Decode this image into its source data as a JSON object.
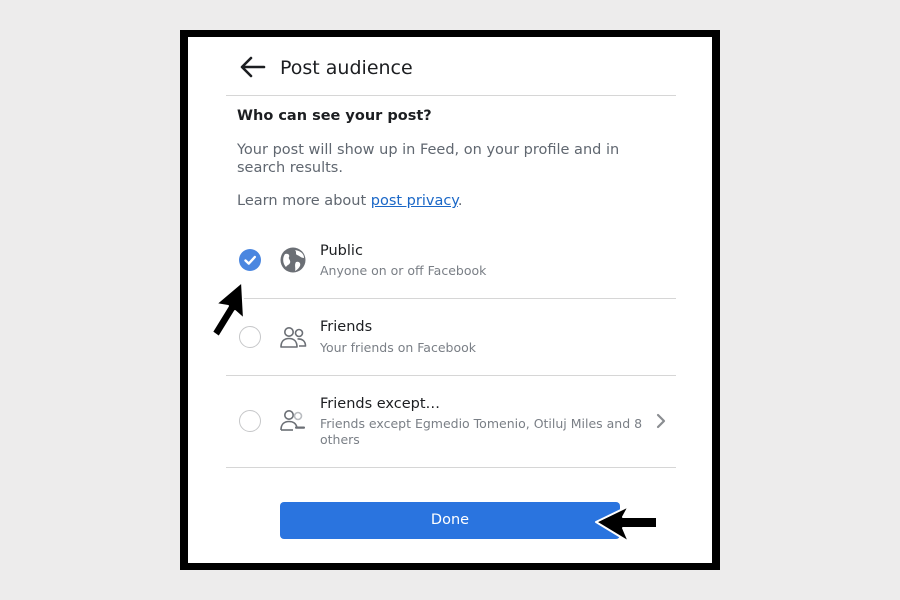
{
  "header": {
    "title": "Post audience",
    "back_icon": "arrow-left-icon"
  },
  "intro": {
    "question": "Who can see your post?",
    "description": "Your post will show up in Feed, on your profile and in search results.",
    "learn_more_prefix": "Learn more about ",
    "learn_more_link": "post privacy",
    "learn_more_suffix": "."
  },
  "options": [
    {
      "label": "Public",
      "subtitle": "Anyone on or off Facebook",
      "icon": "globe-icon",
      "selected": true
    },
    {
      "label": "Friends",
      "subtitle": "Your friends on Facebook",
      "icon": "friends-icon",
      "selected": false
    },
    {
      "label": "Friends except…",
      "subtitle": "Friends except Egmedio Tomenio, Otiluj Miles and 8 others",
      "icon": "friends-except-icon",
      "selected": false,
      "has_chevron": true
    }
  ],
  "footer": {
    "done_label": "Done"
  },
  "colors": {
    "accent": "#2a74df",
    "selected_radio": "#4a86e0",
    "link": "#1a67c7",
    "frame": "#000000",
    "background": "#edecec"
  }
}
